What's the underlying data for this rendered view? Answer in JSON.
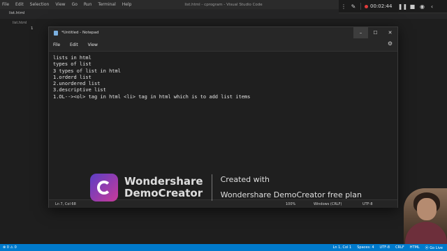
{
  "vscode": {
    "menu": [
      "File",
      "Edit",
      "Selection",
      "View",
      "Go",
      "Run",
      "Terminal",
      "Help"
    ],
    "title": "list.html - cprogram - Visual Studio Code",
    "tab": "list.html",
    "breadcrumb": "list.html",
    "line_number": "1",
    "status_left": [
      "⊗ 0 ⚠ 0"
    ],
    "status_right": [
      "Ln 1, Col 1",
      "Spaces: 4",
      "UTF-8",
      "CRLF",
      "HTML",
      "⦿ Go Live"
    ]
  },
  "recorder": {
    "timer": "00:02:44"
  },
  "notepad": {
    "title": "*Untitled - Notepad",
    "menu": [
      "File",
      "Edit",
      "View"
    ],
    "lines": [
      "lists in html",
      "types of list",
      "3 types of list in html",
      "1.orderd list",
      "2.unordered list",
      "3.descriptive list",
      "1.OL--><ol> tag in html <li> tag in html which is to add list items"
    ],
    "status": {
      "position": "Ln 7, Col 68",
      "zoom": "100%",
      "line_ending": "Windows (CRLF)",
      "encoding": "UTF-8"
    }
  },
  "watermark": {
    "brand_line1": "Wondershare",
    "brand_line2": "DemoCreator",
    "created_with": "Created with",
    "plan": "Wondershare DemoCreator free plan"
  }
}
